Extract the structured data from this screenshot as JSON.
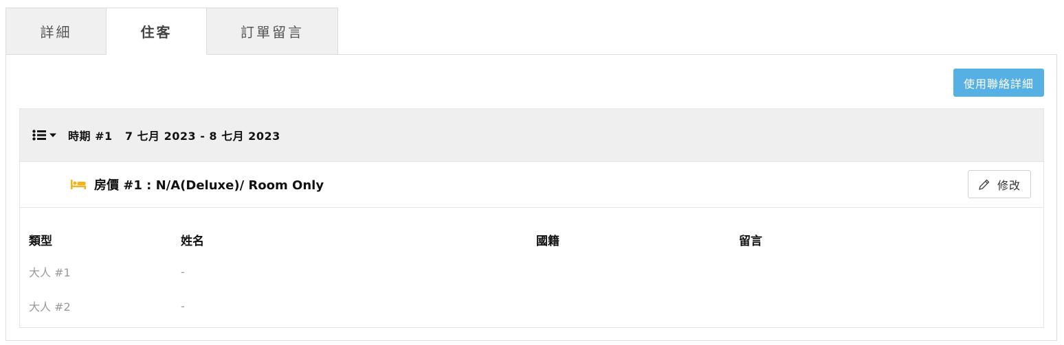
{
  "tabs": [
    {
      "label": "詳細",
      "active": false
    },
    {
      "label": "住客",
      "active": true
    },
    {
      "label": "訂單留言",
      "active": false
    }
  ],
  "contact_button": "使用聯絡詳細",
  "period": {
    "title": "時期 #1   7 七月 2023 - 8 七月 2023",
    "room": {
      "title": "房價 #1 : N/A(Deluxe)/ Room Only",
      "edit_label": "修改"
    },
    "table": {
      "headers": [
        "類型",
        "姓名",
        "國籍",
        "留言"
      ],
      "rows": [
        [
          "大人 #1",
          "-",
          "",
          ""
        ],
        [
          "大人 #2",
          "-",
          "",
          ""
        ]
      ]
    }
  },
  "colors": {
    "accent": "#57b0e3",
    "bed_icon": "#f5b219",
    "header_bg": "#efefef",
    "border": "#dcdcdc"
  },
  "icons": {
    "list_toggle": "list-caret-icon",
    "room": "bed-icon",
    "edit": "pencil-icon"
  }
}
